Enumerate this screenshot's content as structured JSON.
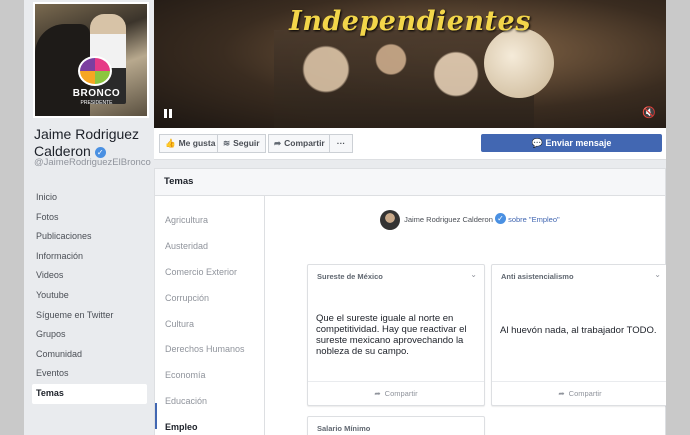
{
  "page": {
    "name_line1": "Jaime Rodriguez",
    "name_line2": "Calderon",
    "verified_badge": "✓",
    "handle": "@JaimeRodriguezElBronco",
    "profile_logo": "BRONCO",
    "profile_logo_sub": "PRESIDENTE",
    "nav": [
      "Inicio",
      "Fotos",
      "Publicaciones",
      "Información",
      "Videos",
      "Youtube",
      "Sígueme en Twitter",
      "Grupos",
      "Comunidad",
      "Eventos",
      "Temas"
    ],
    "nav_active": "Temas"
  },
  "cover": {
    "title": "Independientes",
    "pause_icon": "pause-icon",
    "mute_icon": "muted-speaker-icon"
  },
  "actions": {
    "like": "Me gusta",
    "follow": "Seguir",
    "share": "Compartir",
    "more": "···",
    "message": "Enviar mensaje"
  },
  "temas": {
    "header": "Temas",
    "topics": [
      "Agricultura",
      "Austeridad",
      "Comercio Exterior",
      "Corrupción",
      "Cultura",
      "Derechos Humanos",
      "Economía",
      "Educación",
      "Empleo"
    ],
    "active_topic": "Empleo",
    "author_name": "Jaime Rodriguez Calderon",
    "about_text": "sobre \"Empleo\"",
    "cards": [
      {
        "title": "Sureste de México",
        "text": "Que el sureste iguale al norte en competitividad. Hay que reactivar el sureste mexicano aprovechando la nobleza de su campo.",
        "share": "Compartir"
      },
      {
        "title": "Anti asistencialismo",
        "text": "Al huevón nada, al trabajador TODO.",
        "share": "Compartir"
      },
      {
        "title": "Salario Mínimo"
      }
    ]
  },
  "colors": {
    "brand_blue": "#4267b2",
    "background": "#e9ebee",
    "cover_title": "#f3d64a"
  }
}
